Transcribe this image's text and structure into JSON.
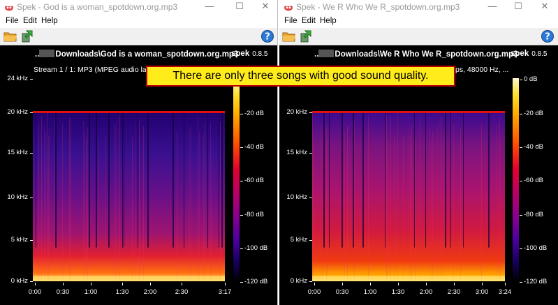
{
  "callout": "There are only three songs with good sound quality.",
  "colors": {
    "cutoff_line": "#e01010",
    "callout_bg": "#ffec1a",
    "callout_border": "#c00000"
  },
  "left_window": {
    "title": "Spek - God is a woman_spotdown.org.mp3",
    "menu": [
      "File",
      "Edit",
      "Help"
    ],
    "toolbar_icons": [
      "open-folder-icon",
      "save-icon",
      "help-icon"
    ],
    "file_path": "Downloads\\God is a woman_spotdown.org.mp3",
    "file_prefix": "..",
    "app_name": "spek",
    "app_version": "0.8.5",
    "stream_info": "Stream 1 / 1: MP3 (MPEG audio layer",
    "frequency_labels": [
      "24 kHz",
      "20 kHz",
      "15 kHz",
      "10 kHz",
      "5 kHz",
      "0 kHz"
    ],
    "time_labels": [
      "0:00",
      "0:30",
      "1:00",
      "1:30",
      "2:00",
      "2:30",
      "3:17"
    ],
    "db_labels": [
      "-20 dB",
      "-40 dB",
      "-60 dB",
      "-80 dB",
      "-100 dB",
      "-120 dB"
    ]
  },
  "right_window": {
    "title": "Spek - We R Who We R_spotdown.org.mp3",
    "menu": [
      "File",
      "Edit",
      "Help"
    ],
    "toolbar_icons": [
      "open-folder-icon",
      "save-icon",
      "help-icon"
    ],
    "file_path": "Downloads\\We R Who We R_spotdown.org.mp3",
    "file_prefix": "..",
    "app_name": "spek",
    "app_version": "0.8.5",
    "stream_info": "ps, 48000 Hz, ...",
    "frequency_labels": [
      "20 kHz",
      "15 kHz",
      "10 kHz",
      "5 kHz",
      "0 kHz"
    ],
    "time_labels": [
      "0:00",
      "0:30",
      "1:00",
      "1:30",
      "2:00",
      "2:30",
      "3:00",
      "3:24"
    ],
    "db_labels": [
      "0 dB",
      "-20 dB",
      "-40 dB",
      "-60 dB",
      "-80 dB",
      "-100 dB",
      "-120 dB"
    ]
  },
  "window_controls": {
    "minimize": "—",
    "maximize": "☐",
    "close": "✕"
  }
}
